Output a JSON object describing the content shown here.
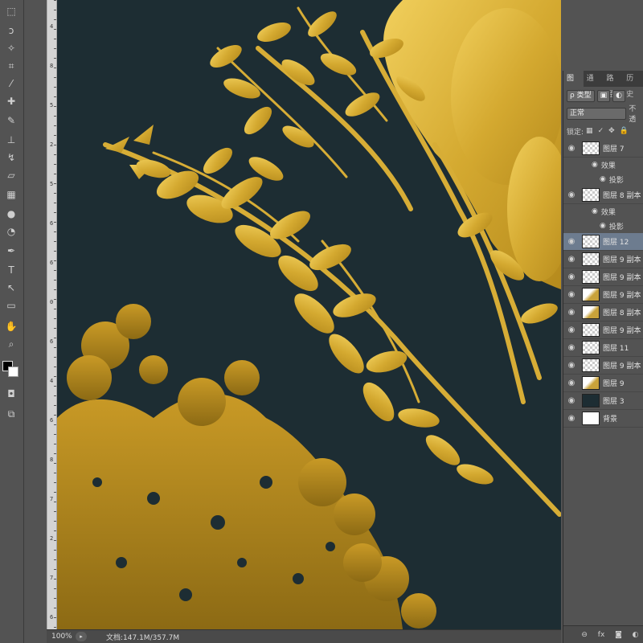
{
  "toolbar": {
    "tools": [
      {
        "name": "marquee-tool-icon",
        "glyph": "⬚"
      },
      {
        "name": "lasso-tool-icon",
        "glyph": "ↄ"
      },
      {
        "name": "magic-wand-tool-icon",
        "glyph": "✧"
      },
      {
        "name": "crop-tool-icon",
        "glyph": "⌗"
      },
      {
        "name": "eyedropper-tool-icon",
        "glyph": "⁄"
      },
      {
        "name": "healing-brush-tool-icon",
        "glyph": "✚"
      },
      {
        "name": "brush-tool-icon",
        "glyph": "✎"
      },
      {
        "name": "clone-stamp-tool-icon",
        "glyph": "⊥"
      },
      {
        "name": "history-brush-tool-icon",
        "glyph": "↯"
      },
      {
        "name": "eraser-tool-icon",
        "glyph": "▱"
      },
      {
        "name": "gradient-tool-icon",
        "glyph": "▦"
      },
      {
        "name": "blur-tool-icon",
        "glyph": "●"
      },
      {
        "name": "dodge-tool-icon",
        "glyph": "◔"
      },
      {
        "name": "pen-tool-icon",
        "glyph": "✒"
      },
      {
        "name": "type-tool-icon",
        "glyph": "T"
      },
      {
        "name": "path-selection-tool-icon",
        "glyph": "↖"
      },
      {
        "name": "rectangle-tool-icon",
        "glyph": "▭"
      },
      {
        "name": "hand-tool-icon",
        "glyph": "✋"
      },
      {
        "name": "zoom-tool-icon",
        "glyph": "⌕"
      }
    ],
    "mode_icons": [
      {
        "name": "quick-mask-icon",
        "glyph": "◘"
      },
      {
        "name": "screen-mode-icon",
        "glyph": "⧉"
      }
    ],
    "foreground_color": "#000000",
    "background_color": "#ffffff"
  },
  "ruler": {
    "labels": [
      "4",
      "8",
      "5",
      "2",
      "5",
      "6",
      "6",
      "0",
      "6",
      "4",
      "6",
      "8",
      "7",
      "2",
      "7",
      "6"
    ]
  },
  "status": {
    "zoom": "100%",
    "doc_info": "文档:147.1M/357.7M"
  },
  "layers_panel": {
    "tabs": [
      "图层",
      "通道",
      "路径",
      "历史"
    ],
    "filter_label": "ρ 类型",
    "blend_mode": "正常",
    "opacity_label": "不透",
    "lock_label": "锁定:",
    "lock_icons": [
      "▦",
      "✓",
      "✥",
      "🔒"
    ],
    "layers": [
      {
        "name": "图层 7",
        "thumb": "checker",
        "effects": true,
        "effect_label": "效果",
        "effect_item": "投影"
      },
      {
        "name": "图层 8 副本",
        "thumb": "checker",
        "effects": true,
        "effect_label": "效果",
        "effect_item": "投影"
      },
      {
        "name": "图层 12",
        "thumb": "checker",
        "selected": true
      },
      {
        "name": "图层 9 副本",
        "thumb": "checker"
      },
      {
        "name": "图层 9 副本",
        "thumb": "checker"
      },
      {
        "name": "图层 9 副本",
        "thumb": "gold"
      },
      {
        "name": "图层 8 副本",
        "thumb": "gold"
      },
      {
        "name": "图层 9 副本",
        "thumb": "checker"
      },
      {
        "name": "图层 11",
        "thumb": "checker"
      },
      {
        "name": "图层 9 副本",
        "thumb": "checker"
      },
      {
        "name": "图层 9",
        "thumb": "gold"
      },
      {
        "name": "图层 3",
        "thumb": "dark"
      },
      {
        "name": "背景",
        "thumb": "white"
      }
    ],
    "footer_icons": [
      "⊖",
      "fx",
      "◙",
      "◐"
    ]
  },
  "canvas": {
    "background_color": "#1d2d33",
    "gold_color": "#d4a930"
  }
}
